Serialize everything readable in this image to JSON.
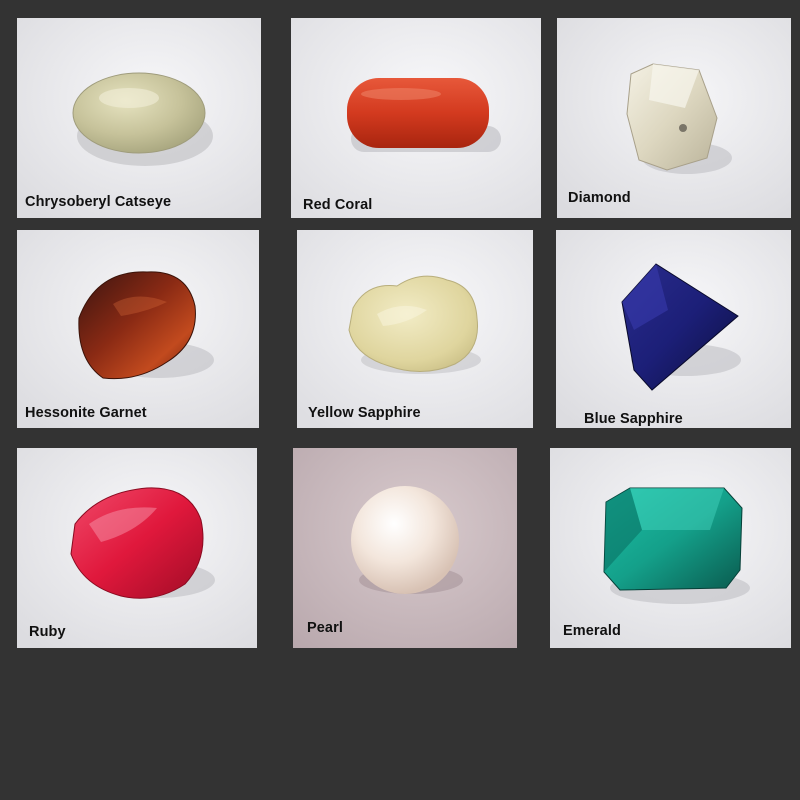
{
  "colors": {
    "page_background": "#333333",
    "label_text": "#111111",
    "card_background": "#e8e8e8",
    "pearl_card_background": "#c9b9bd"
  },
  "gems": [
    {
      "label": "Chrysoberyl Catseye",
      "gem_color": "#c8c59c"
    },
    {
      "label": "Red Coral",
      "gem_color": "#d63a20"
    },
    {
      "label": "Diamond",
      "gem_color": "#e6e1cf"
    },
    {
      "label": "Hessonite Garnet",
      "gem_color": "#8a2a14"
    },
    {
      "label": "Yellow Sapphire",
      "gem_color": "#e4dcaa"
    },
    {
      "label": "Blue Sapphire",
      "gem_color": "#1c1f78"
    },
    {
      "label": "Ruby",
      "gem_color": "#e0183c"
    },
    {
      "label": "Pearl",
      "gem_color": "#f3e6dc"
    },
    {
      "label": "Emerald",
      "gem_color": "#14a08a"
    }
  ]
}
